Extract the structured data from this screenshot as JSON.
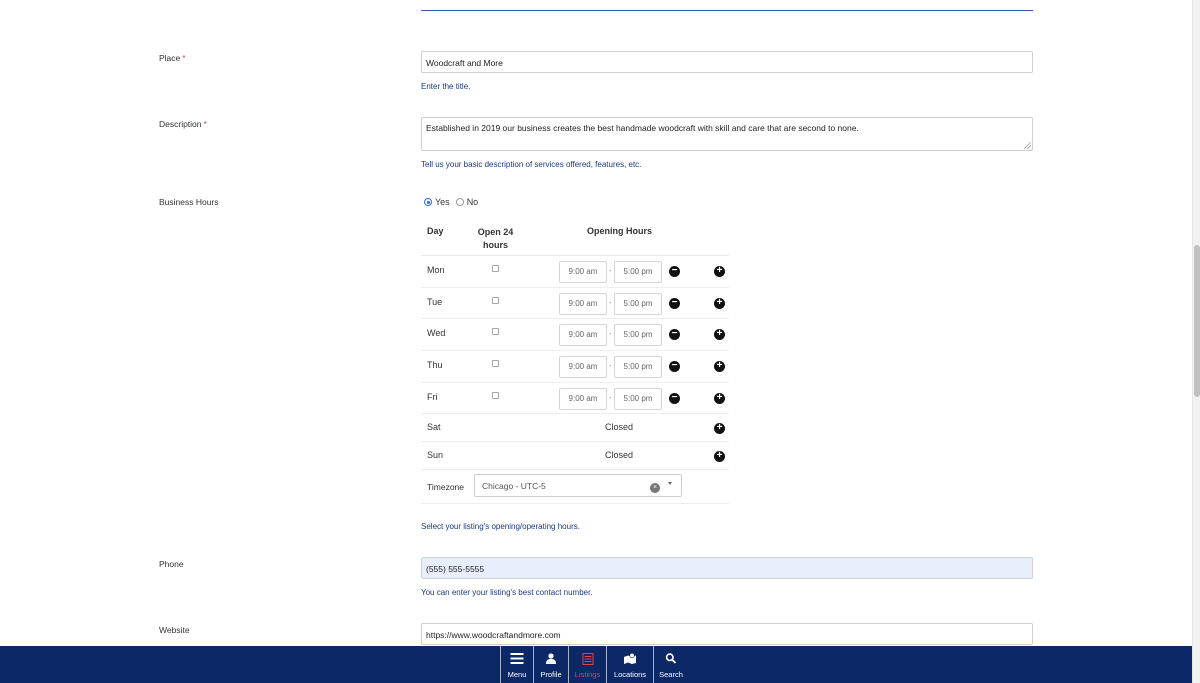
{
  "form": {
    "place": {
      "label": "Place",
      "required_mark": "*",
      "value": "Woodcraft and More",
      "help": "Enter the title."
    },
    "description": {
      "label": "Description",
      "required_mark": "*",
      "value": "Established in 2019 our business creates the best handmade woodcraft with skill and care that are second to none.",
      "help": "Tell us your basic description of services offered, features, etc."
    },
    "business_hours": {
      "label": "Business Hours",
      "options": [
        "Yes",
        "No"
      ],
      "selected": "Yes",
      "headers": {
        "day": "Day",
        "open24": "Open 24 hours",
        "opening_hours": "Opening Hours"
      },
      "days": [
        {
          "day": "Mon",
          "open": "9:00 am",
          "close": "5:00 pm"
        },
        {
          "day": "Tue",
          "open": "9:00 am",
          "close": "5:00 pm"
        },
        {
          "day": "Wed",
          "open": "9:00 am",
          "close": "5:00 pm"
        },
        {
          "day": "Thu",
          "open": "9:00 am",
          "close": "5:00 pm"
        },
        {
          "day": "Fri",
          "open": "9:00 am",
          "close": "5:00 pm"
        },
        {
          "day": "Sat",
          "status": "Closed"
        },
        {
          "day": "Sun",
          "status": "Closed"
        }
      ],
      "separator": "-",
      "timezone_label": "Timezone",
      "timezone_value": "Chicago - UTC-5",
      "help": "Select your listing's opening/operating hours."
    },
    "phone": {
      "label": "Phone",
      "value": "(555) 555-5555",
      "help": "You can enter your listing's best contact number."
    },
    "website": {
      "label": "Website",
      "value": "https://www.woodcraftandmore.com"
    }
  },
  "bottom_nav": {
    "items": [
      {
        "label": "Menu",
        "icon": "hamburger-icon"
      },
      {
        "label": "Profile",
        "icon": "person-icon"
      },
      {
        "label": "Listings",
        "icon": "list-icon",
        "active": true
      },
      {
        "label": "Locations",
        "icon": "map-pin-icon"
      },
      {
        "label": "Search",
        "icon": "search-icon"
      }
    ]
  },
  "colors": {
    "nav_background": "#0c2867",
    "active_nav": "#e5403f",
    "help_text": "#1b3a7a",
    "required": "#e0454d"
  }
}
